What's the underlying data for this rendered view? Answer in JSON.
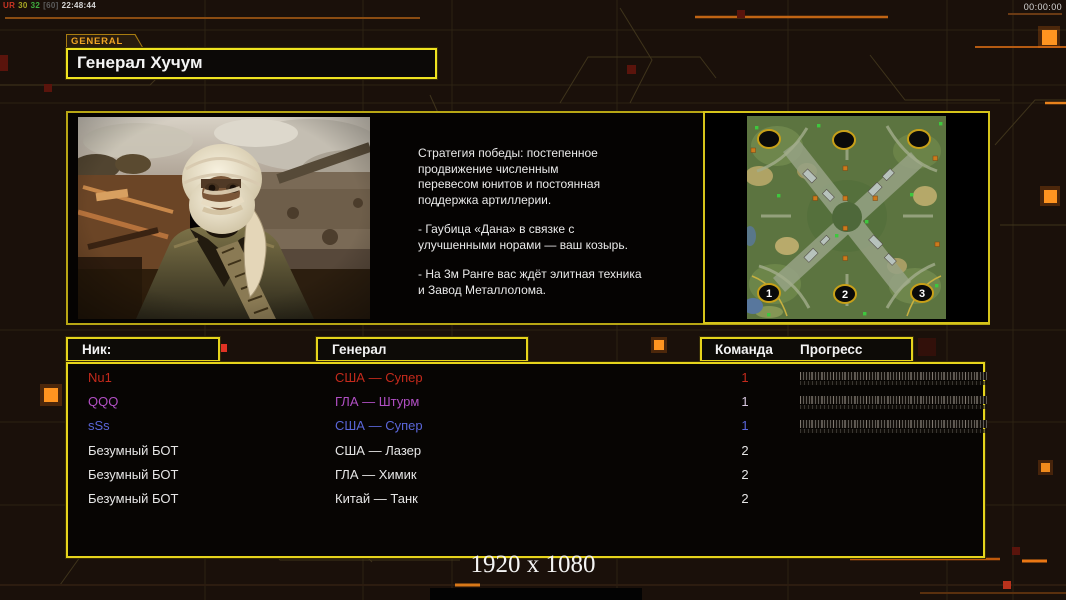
{
  "hud": {
    "debug": {
      "label": "UR",
      "value1": "30",
      "value2": "32",
      "value3": "[60]",
      "time": "22:48:44"
    },
    "timer": "00:00:00",
    "resolution": "1920 x 1080"
  },
  "general_panel": {
    "tab_label": "GENERAL",
    "title": "Генерал Хучум",
    "portrait": "bandaged-general-portrait",
    "strategy_paragraphs": [
      "Стратегия победы: постепенное\nпродвижение численным\nперевесом юнитов и постоянная\nподдержка артиллерии.",
      "- Гаубица «Дана» в связке с\nулучшенными норами — ваш козырь.",
      "- На 3м Ранге вас ждёт элитная техника\nи Завод Металлолома."
    ]
  },
  "map_preview": {
    "name": "urban-crossroads-minimap",
    "spawn_labels": [
      "1",
      "2",
      "3"
    ]
  },
  "players_table": {
    "headers": {
      "nick": "Ник:",
      "general": "Генерал",
      "team": "Команда",
      "progress": "Прогресс"
    },
    "rows": [
      {
        "nick": "Nu1",
        "general": "США — Супер",
        "team": "1",
        "color": "#c42a1c",
        "team_color": "#c42a1c",
        "has_progress": true
      },
      {
        "nick": "QQQ",
        "general": "ГЛА — Штурм",
        "team": "1",
        "color": "#b14fc4",
        "team_color": "#d8c8e0",
        "has_progress": true
      },
      {
        "nick": "sSs",
        "general": "США — Супер",
        "team": "1",
        "color": "#5a66d8",
        "team_color": "#5a66d8",
        "has_progress": true
      },
      {
        "nick": "Безумный БОТ",
        "general": "США — Лазер",
        "team": "2",
        "color": "#e6e6e6",
        "team_color": "#e6e6e6",
        "has_progress": false
      },
      {
        "nick": "Безумный БОТ",
        "general": "ГЛА — Химик",
        "team": "2",
        "color": "#e6e6e6",
        "team_color": "#e6e6e6",
        "has_progress": false
      },
      {
        "nick": "Безумный БОТ",
        "general": "Китай — Танк",
        "team": "2",
        "color": "#e6e6e6",
        "team_color": "#e6e6e6",
        "has_progress": false
      }
    ]
  },
  "colors": {
    "border_yellow": "#e6d41c",
    "accent_orange": "#e07818",
    "background": "#1a100a",
    "player_red": "#c42a1c",
    "player_purple": "#b14fc4",
    "player_blue": "#5a66d8"
  }
}
